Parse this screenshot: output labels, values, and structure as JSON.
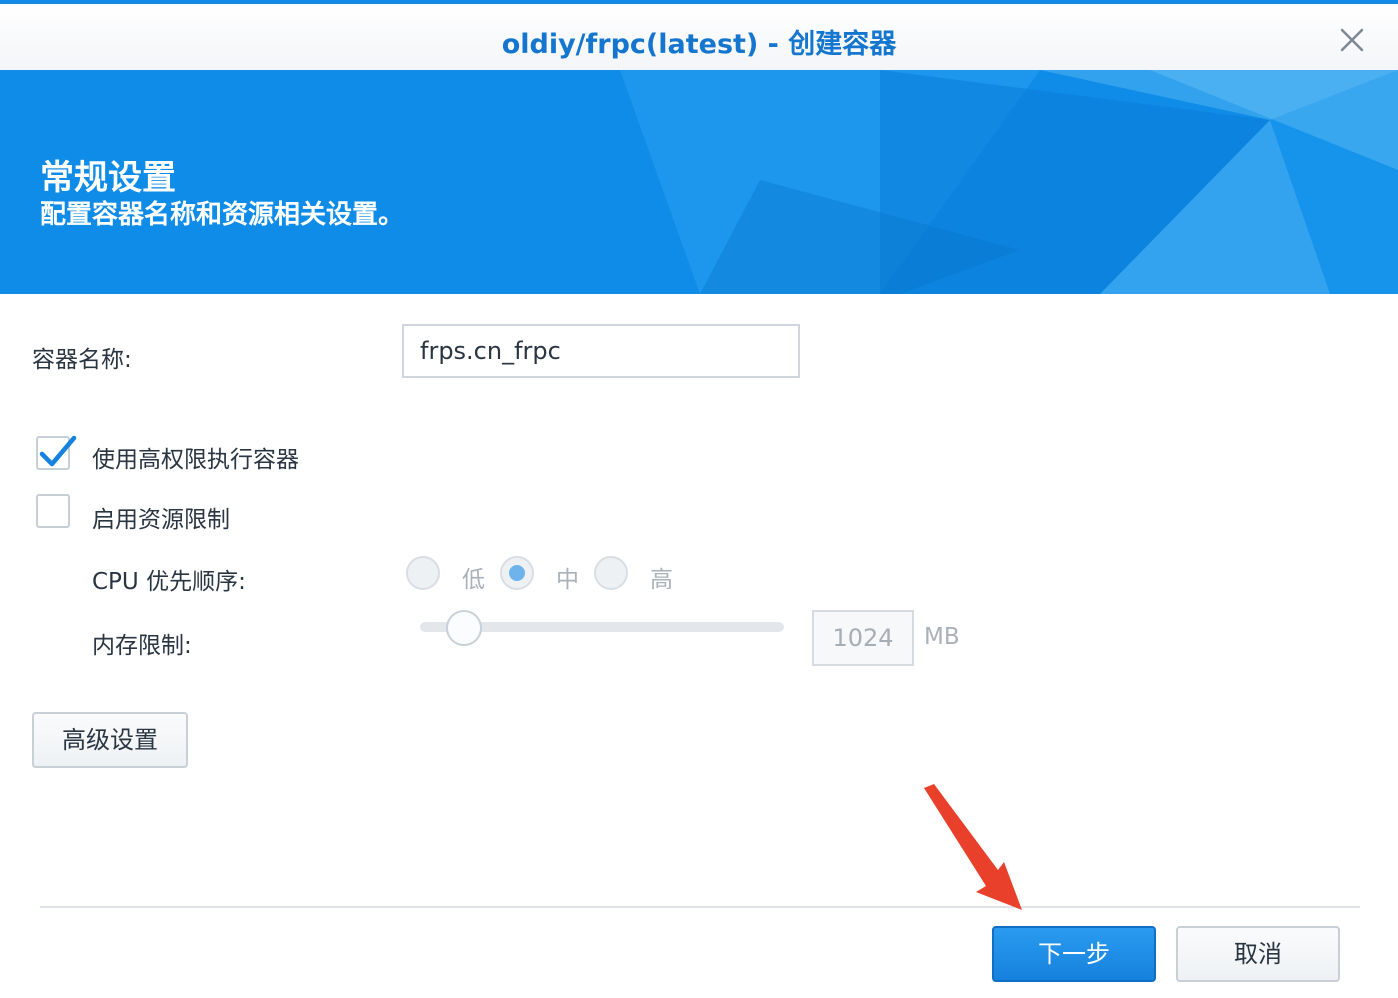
{
  "window": {
    "title": "oldiy/frpc(latest) - 创建容器",
    "accent_color": "#1589e6",
    "title_color": "#1476cf",
    "close_icon": "close-icon"
  },
  "banner": {
    "title": "常规设置",
    "subtitle": "配置容器名称和资源相关设置。",
    "color": "#1190ea"
  },
  "form": {
    "container_name_label": "容器名称:",
    "container_name_value": "frps.cn_frpc",
    "privileged": {
      "label": "使用高权限执行容器",
      "checked": true
    },
    "resource_limit": {
      "label": "启用资源限制",
      "checked": false
    },
    "cpu_priority": {
      "label": "CPU 优先顺序:",
      "options": [
        "低",
        "中",
        "高"
      ],
      "selected": "中"
    },
    "memory_limit": {
      "label": "内存限制:",
      "value": "1024",
      "unit": "MB"
    },
    "advanced_button": "高级设置"
  },
  "footer": {
    "next_button": "下一步",
    "cancel_button": "取消",
    "primary_color": "#1681dd"
  },
  "annotation": {
    "arrow_color": "#e8402a",
    "points_to": "next-button"
  }
}
